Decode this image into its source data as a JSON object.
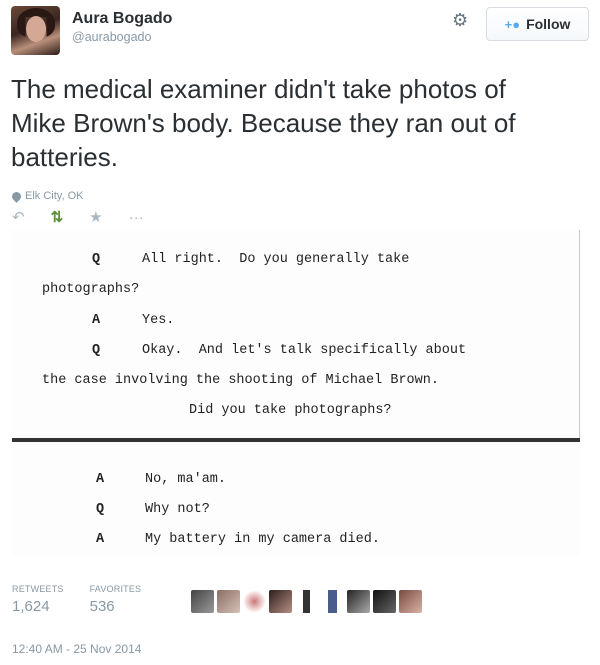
{
  "user": {
    "name": "Aura Bogado",
    "handle": "@aurabogado"
  },
  "header": {
    "follow_label": "Follow"
  },
  "tweet": {
    "lines": [
      "The medical examiner didn't take photos of",
      "Mike Brown's body. Because they ran out of",
      "batteries."
    ],
    "location": "Elk City, OK"
  },
  "document": {
    "lines": [
      {
        "label": "Q",
        "text": "All right.  Do you generally take"
      },
      {
        "label": "",
        "text": "photographs?"
      },
      {
        "label": "A",
        "text": "Yes."
      },
      {
        "label": "Q",
        "text": "Okay.  And let's talk specifically about"
      },
      {
        "label": "",
        "text": "the case involving the shooting of Michael Brown."
      },
      {
        "label": "",
        "text": "Did you take photographs?"
      },
      {
        "label": "A",
        "text": "No, ma'am."
      },
      {
        "label": "Q",
        "text": "Why not?"
      },
      {
        "label": "A",
        "text": "My battery in my camera died."
      }
    ]
  },
  "stats": {
    "retweets_label": "RETWEETS",
    "retweets": "1,624",
    "favorites_label": "FAVORITES",
    "favorites": "536"
  },
  "timestamp": "12:40 AM - 25 Nov 2014",
  "icons": {
    "gear": "gear-icon",
    "follow": "follow-person-icon",
    "location": "location-pin-icon",
    "reply": "reply-icon",
    "retweet": "retweet-icon",
    "favorite": "star-icon",
    "more": "more-icon"
  },
  "colors": {
    "retweeted": "#5c913b",
    "follow_icon": "#55acee",
    "muted": "#8899a6"
  }
}
